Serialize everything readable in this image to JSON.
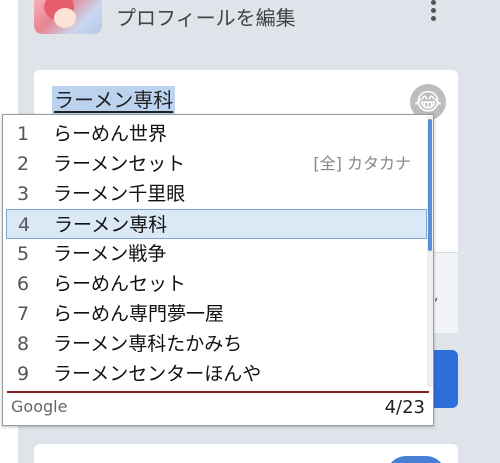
{
  "header": {
    "edit_profile_label": "プロフィールを編集",
    "menu_icon": "more-vert-icon"
  },
  "composer": {
    "text": "ラーメン専科",
    "emoji_icon": "grinning-tears-emoji-icon"
  },
  "ime": {
    "candidates": [
      {
        "num": "1",
        "word": "らーめん世界",
        "annotation": ""
      },
      {
        "num": "2",
        "word": "ラーメンセット",
        "annotation": "[全] カタカナ"
      },
      {
        "num": "3",
        "word": "ラーメン千里眼",
        "annotation": ""
      },
      {
        "num": "4",
        "word": "ラーメン専科",
        "annotation": ""
      },
      {
        "num": "5",
        "word": "ラーメン戦争",
        "annotation": ""
      },
      {
        "num": "6",
        "word": "らーめんセット",
        "annotation": ""
      },
      {
        "num": "7",
        "word": "らーめん専門夢一屋",
        "annotation": ""
      },
      {
        "num": "8",
        "word": "ラーメン専科たかみち",
        "annotation": ""
      },
      {
        "num": "9",
        "word": "ラーメンセンターほんや",
        "annotation": ""
      }
    ],
    "selected_index": 3,
    "brand": "Google",
    "count": "4/23"
  },
  "colors": {
    "selection_highlight": "#bcd3ef",
    "selected_row": "#dbe8f6",
    "accent_blue": "#2e6fd8",
    "footer_line": "#8b1a1a"
  }
}
